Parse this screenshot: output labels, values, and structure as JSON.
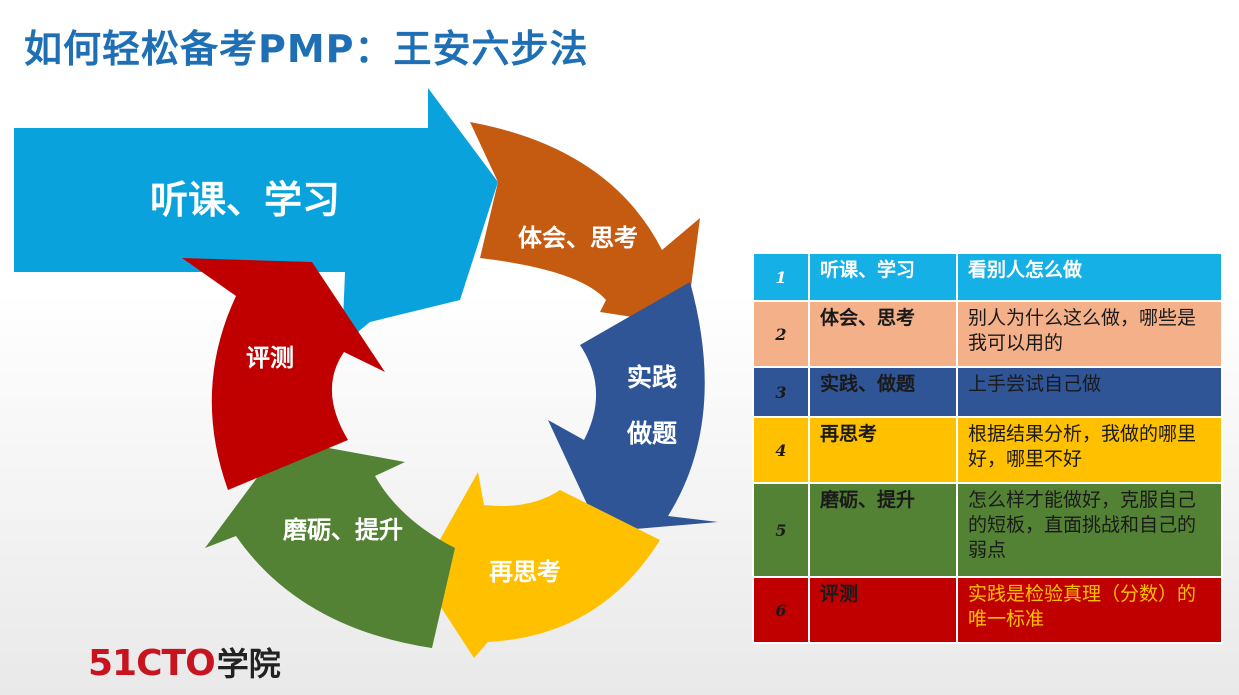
{
  "title": "如何轻松备考PMP：王安六步法",
  "cycle": {
    "step1": "听课、学习",
    "step2": "体会、思考",
    "step3_line1": "实践",
    "step3_line2": "做题",
    "step4": "再思考",
    "step5": "磨砺、提升",
    "step6": "评测"
  },
  "colors": {
    "step1": "#0aa2dd",
    "step2": "#c55a11",
    "step3": "#2f5597",
    "step4": "#ffc000",
    "step5": "#548235",
    "step6": "#c00000",
    "title": "#1f6fb5"
  },
  "table": {
    "rows": [
      {
        "num": "1",
        "name": "听课、学习",
        "desc": "看别人怎么做"
      },
      {
        "num": "2",
        "name": "体会、思考",
        "desc": "别人为什么这么做，哪些是我可以用的"
      },
      {
        "num": "3",
        "name": "实践、做题",
        "desc": "上手尝试自己做"
      },
      {
        "num": "4",
        "name": "再思考",
        "desc": "根据结果分析，我做的哪里好，哪里不好"
      },
      {
        "num": "5",
        "name": "磨砺、提升",
        "desc": "怎么样才能做好，克服自己的短板，直面挑战和自己的弱点"
      },
      {
        "num": "6",
        "name": "评测",
        "desc": "实践是检验真理（分数）的唯一标准"
      }
    ]
  },
  "logo": {
    "brand": "51CTO",
    "suffix": "学院"
  }
}
